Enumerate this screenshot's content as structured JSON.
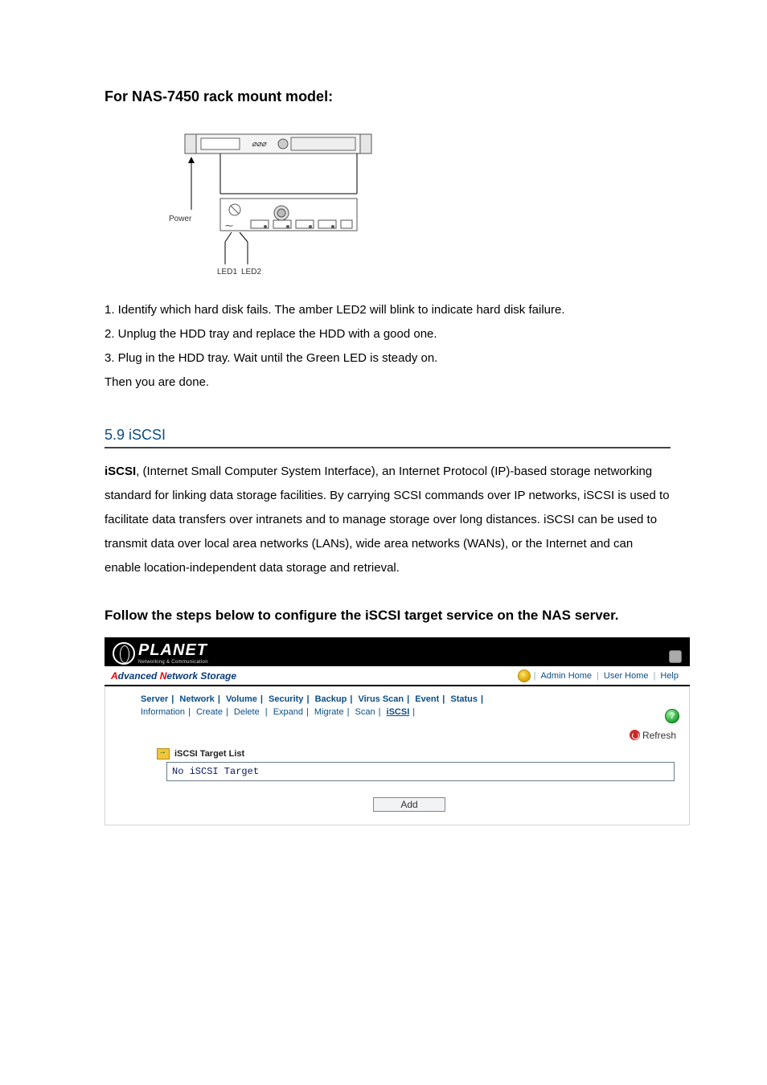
{
  "heading_model": "For NAS-7450 rack mount model:",
  "diagram": {
    "power_label": "Power",
    "led1_label": "LED1",
    "led2_label": "LED2"
  },
  "steps": {
    "s1": "1. Identify which hard disk fails. The amber LED2 will blink to indicate hard disk failure.",
    "s2": "2. Unplug the HDD tray and replace the HDD with a good one.",
    "s3": "3. Plug in the HDD tray. Wait until the Green LED is steady on.",
    "done": "Then you are done."
  },
  "section_title": "5.9 iSCSI",
  "section_body_bold": "iSCSI",
  "section_body_rest": ", (Internet Small Computer System Interface), an Internet Protocol (IP)-based storage networking standard for linking data storage facilities. By carrying SCSI commands over IP networks, iSCSI is used to facilitate data transfers over intranets and to manage storage over long distances. iSCSI can be used to transmit data over local area networks (LANs), wide area networks (WANs), or the Internet and can enable location-independent data storage and retrieval.",
  "step_heading": "Follow the steps below to configure the iSCSI target service on the NAS server.",
  "ui": {
    "logo_text": "PLANET",
    "logo_sub": "Networking & Communication",
    "app_title_a": "A",
    "app_title_dvanced": "dvanced ",
    "app_title_n": "N",
    "app_title_etwork": "etwork Storage",
    "top_links": {
      "admin": "Admin Home",
      "user": "User Home",
      "help": "Help"
    },
    "main_tabs": [
      "Server",
      "Network",
      "Volume",
      "Security",
      "Backup",
      "Virus Scan",
      "Event",
      "Status"
    ],
    "sub_tabs": [
      "Information",
      "Create",
      "Delete",
      "Expand",
      "Migrate",
      "Scan",
      "iSCSI"
    ],
    "active_sub": "iSCSI",
    "refresh_label": "Refresh",
    "panel_title": "iSCSI Target List",
    "list_empty": "No iSCSI Target",
    "add_button": "Add",
    "help_icon_char": "?"
  }
}
